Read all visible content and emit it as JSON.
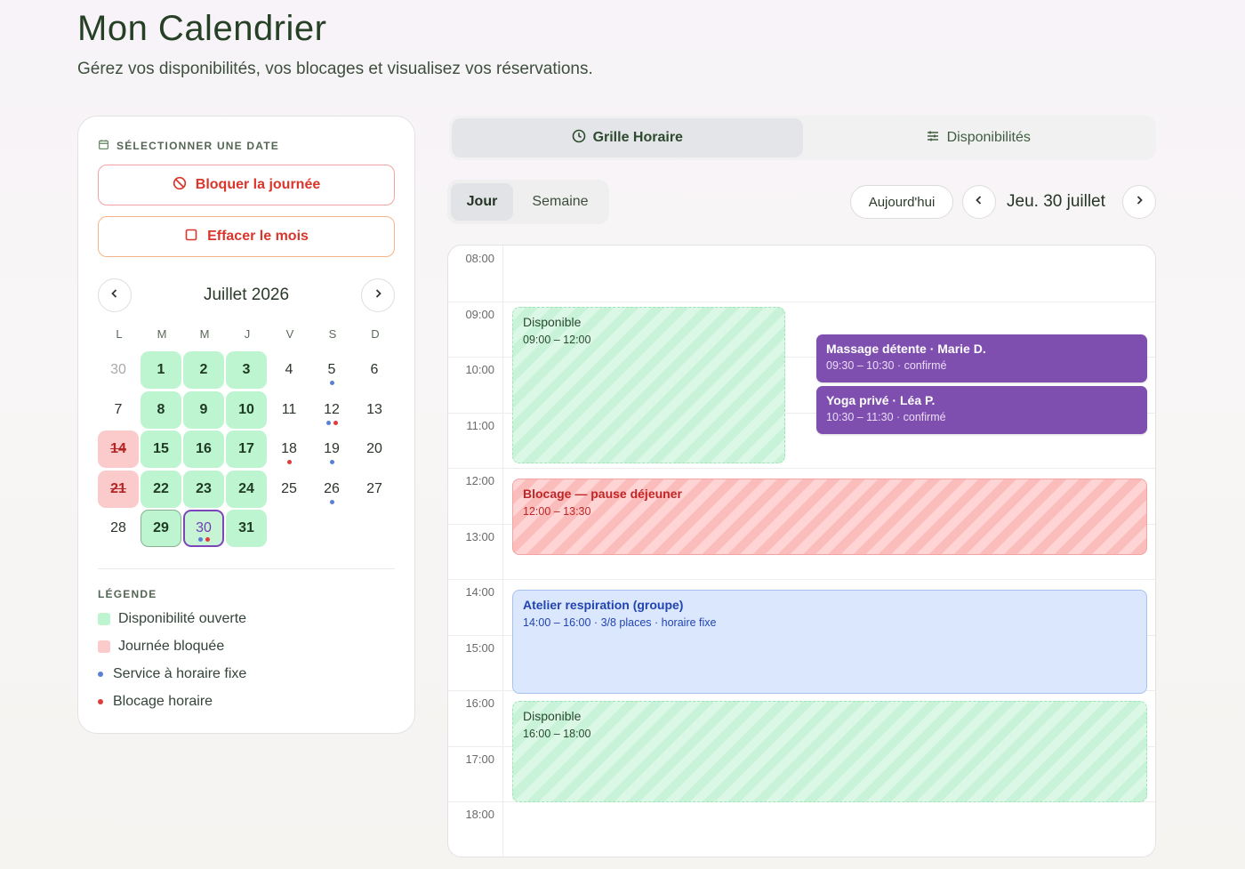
{
  "header": {
    "title": "Mon Calendrier",
    "subtitle": "Gérez vos disponibilités, vos blocages et visualisez vos réservations."
  },
  "date_picker": {
    "section_title": "SÉLECTIONNER UNE DATE",
    "block_day_label": "Bloquer la journée",
    "clear_month_label": "Effacer le mois",
    "month_label": "Juillet 2026",
    "weekdays": [
      "L",
      "M",
      "M",
      "J",
      "V",
      "S",
      "D"
    ],
    "days": [
      {
        "n": "30",
        "state": "muted"
      },
      {
        "n": "1",
        "state": "avail"
      },
      {
        "n": "2",
        "state": "avail"
      },
      {
        "n": "3",
        "state": "avail"
      },
      {
        "n": "4",
        "state": ""
      },
      {
        "n": "5",
        "state": "",
        "dots": [
          "blue"
        ]
      },
      {
        "n": "6",
        "state": ""
      },
      {
        "n": "7",
        "state": ""
      },
      {
        "n": "8",
        "state": "avail"
      },
      {
        "n": "9",
        "state": "avail"
      },
      {
        "n": "10",
        "state": "avail"
      },
      {
        "n": "11",
        "state": ""
      },
      {
        "n": "12",
        "state": "",
        "dots": [
          "blue",
          "red"
        ]
      },
      {
        "n": "13",
        "state": ""
      },
      {
        "n": "14",
        "state": "blocked"
      },
      {
        "n": "15",
        "state": "avail"
      },
      {
        "n": "16",
        "state": "avail"
      },
      {
        "n": "17",
        "state": "avail"
      },
      {
        "n": "18",
        "state": "",
        "dots": [
          "red"
        ]
      },
      {
        "n": "19",
        "state": "",
        "dots": [
          "blue"
        ]
      },
      {
        "n": "20",
        "state": ""
      },
      {
        "n": "21",
        "state": "blocked"
      },
      {
        "n": "22",
        "state": "avail"
      },
      {
        "n": "23",
        "state": "avail"
      },
      {
        "n": "24",
        "state": "avail"
      },
      {
        "n": "25",
        "state": ""
      },
      {
        "n": "26",
        "state": "",
        "dots": [
          "blue"
        ]
      },
      {
        "n": "27",
        "state": ""
      },
      {
        "n": "28",
        "state": ""
      },
      {
        "n": "29",
        "state": "avail sel29"
      },
      {
        "n": "30",
        "state": "sel30",
        "dots": [
          "blue",
          "red"
        ]
      },
      {
        "n": "31",
        "state": "avail"
      }
    ],
    "legend_title": "LÉGENDE",
    "legend": [
      {
        "kind": "swatch-green",
        "label": "Disponibilité ouverte"
      },
      {
        "kind": "swatch-red",
        "label": "Journée bloquée"
      },
      {
        "kind": "dot-blue",
        "label": "Service à horaire fixe"
      },
      {
        "kind": "dot-red",
        "label": "Blocage horaire"
      }
    ]
  },
  "view_tabs": {
    "grid_label": "Grille Horaire",
    "availability_label": "Disponibilités"
  },
  "mode_tabs": {
    "day_label": "Jour",
    "week_label": "Semaine"
  },
  "date_nav": {
    "today_label": "Aujourd'hui",
    "current_date": "Jeu. 30 juillet"
  },
  "timegrid": {
    "hours": [
      "08:00",
      "09:00",
      "10:00",
      "11:00",
      "12:00",
      "13:00",
      "14:00",
      "15:00",
      "16:00",
      "17:00",
      "18:00"
    ],
    "events": [
      {
        "type": "avail",
        "title": "Disponible",
        "sub": "09:00 – 12:00",
        "start": 9.0,
        "end": 11.85,
        "lane": "left"
      },
      {
        "type": "booking",
        "title": "Massage détente · Marie D.",
        "sub": "09:30 – 10:30 · confirmé",
        "start": 9.5,
        "end": 10.4,
        "lane": "right"
      },
      {
        "type": "booking",
        "title": "Yoga privé · Léa P.",
        "sub": "10:30 – 11:30 · confirmé",
        "start": 10.43,
        "end": 11.33,
        "lane": "right"
      },
      {
        "type": "block",
        "title": "Blocage — pause déjeuner",
        "sub": "12:00 – 13:30",
        "start": 12.1,
        "end": 13.5,
        "lane": "full"
      },
      {
        "type": "group",
        "title": "Atelier respiration (groupe)",
        "sub": "14:00 – 16:00 · 3/8 places · horaire fixe",
        "start": 14.1,
        "end": 16.0,
        "lane": "full"
      },
      {
        "type": "avail",
        "title": "Disponible",
        "sub": "16:00 – 18:00",
        "start": 16.1,
        "end": 17.95,
        "lane": "full"
      }
    ]
  },
  "colors": {
    "available": "#bcf5cf",
    "blocked": "#fbcaca",
    "booking": "#7f4fb0",
    "fixed_service": "#5b7fd6",
    "hour_block": "#e03c3c"
  }
}
